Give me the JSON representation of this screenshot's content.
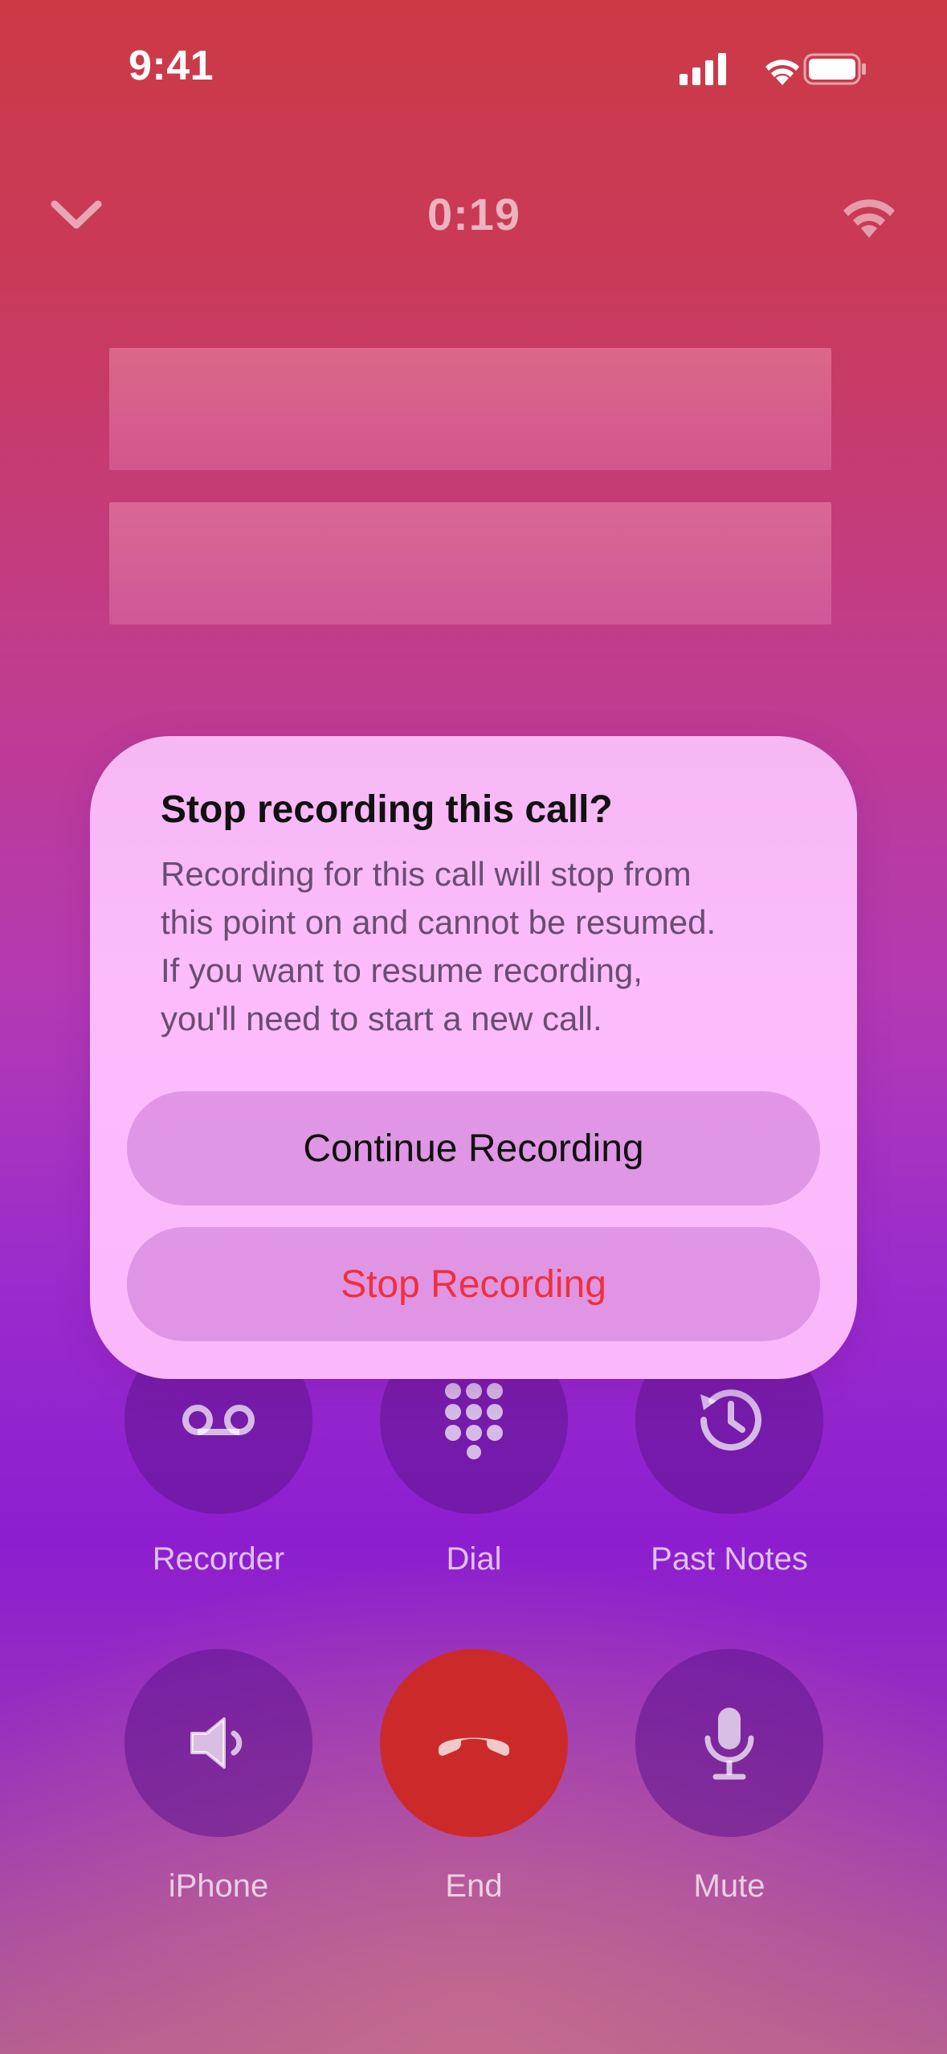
{
  "status_bar": {
    "time": "9:41",
    "icons": [
      "signal-icon",
      "wifi-icon",
      "battery-icon"
    ]
  },
  "call": {
    "timer": "0:19",
    "collapse_icon": "chevron-down-icon",
    "connection_icon": "wifi-calling-icon"
  },
  "dialog": {
    "title": "Stop recording this call?",
    "message_lines": [
      "Recording for this call will stop from",
      "this point on and cannot be resumed.",
      "If you want to resume recording,",
      "you'll need to start a new call."
    ],
    "continue_label": "Continue Recording",
    "stop_label": "Stop Recording"
  },
  "controls": {
    "row1": [
      {
        "label": "Recorder",
        "icon": "voicemail-icon"
      },
      {
        "label": "Dial",
        "icon": "keypad-icon"
      },
      {
        "label": "Past Notes",
        "icon": "history-icon"
      }
    ],
    "row2": [
      {
        "label": "iPhone",
        "icon": "speaker-icon"
      },
      {
        "label": "End",
        "icon": "end-call-icon"
      },
      {
        "label": "Mute",
        "icon": "microphone-icon"
      }
    ]
  },
  "colors": {
    "end_call": "#cc2a2a",
    "stop_text": "#f0303a",
    "dialog_bg": "#fcbcfc"
  }
}
